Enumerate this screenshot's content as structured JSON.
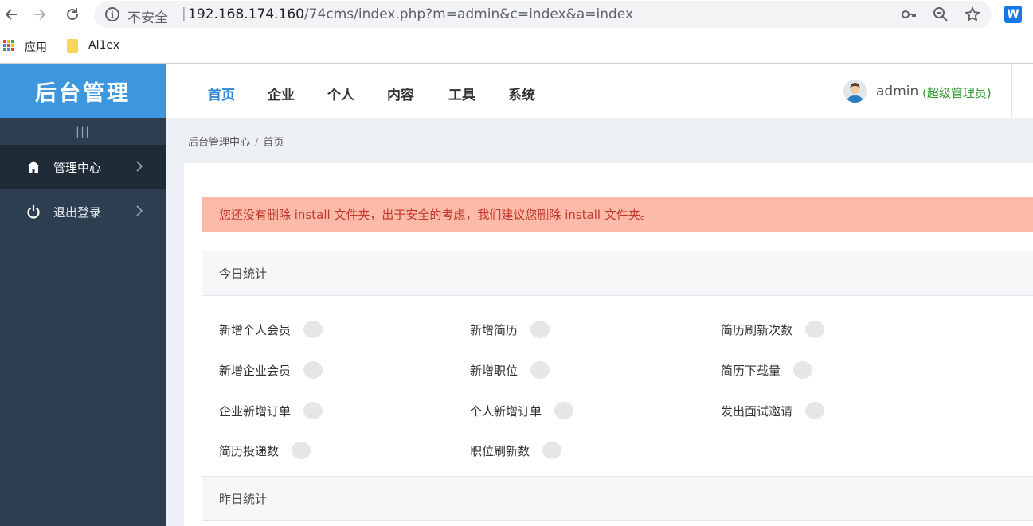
{
  "browser": {
    "insecure_label": "不安全",
    "url_host": "192.168.174.160",
    "url_path": "/74cms/index.php?m=admin&c=index&a=index",
    "bookmarks": [
      {
        "label": "应用",
        "icon": "apps-grid-icon"
      },
      {
        "label": "Al1ex",
        "icon": "folder-icon"
      }
    ],
    "extension_label": "W"
  },
  "sidebar": {
    "logo": "后台管理",
    "collapse_glyph": "|||",
    "items": [
      {
        "label": "管理中心",
        "icon": "home-icon",
        "active": true
      },
      {
        "label": "退出登录",
        "icon": "power-icon",
        "active": false
      }
    ]
  },
  "topbar": {
    "tabs": [
      "首页",
      "企业",
      "个人",
      "内容",
      "工具",
      "系统"
    ],
    "active_tab": "首页",
    "user_name": "admin",
    "user_role": "(超级管理员)"
  },
  "breadcrumb": [
    "后台管理中心",
    "首页"
  ],
  "alert": "您还没有删除 install 文件夹，出于安全的考虑，我们建议您删除 install 文件夹。",
  "today": {
    "title": "今日统计",
    "stats": [
      {
        "label": "新增个人会员"
      },
      {
        "label": "新增简历"
      },
      {
        "label": "简历刷新次数"
      },
      {
        "label": "新增企业会员"
      },
      {
        "label": "新增职位"
      },
      {
        "label": "简历下载量"
      },
      {
        "label": "企业新增订单"
      },
      {
        "label": "个人新增订单"
      },
      {
        "label": "发出面试邀请"
      },
      {
        "label": "简历投递数"
      },
      {
        "label": "职位刷新数"
      }
    ]
  },
  "yesterday": {
    "title": "昨日统计"
  },
  "colors": {
    "sidebar_bg": "#2d3e50",
    "logo_bg": "#3d97df",
    "accent": "#2f86d6",
    "alert_bg": "#fbbba8",
    "alert_text": "#c0392b",
    "role_green": "#2e9b2e"
  }
}
